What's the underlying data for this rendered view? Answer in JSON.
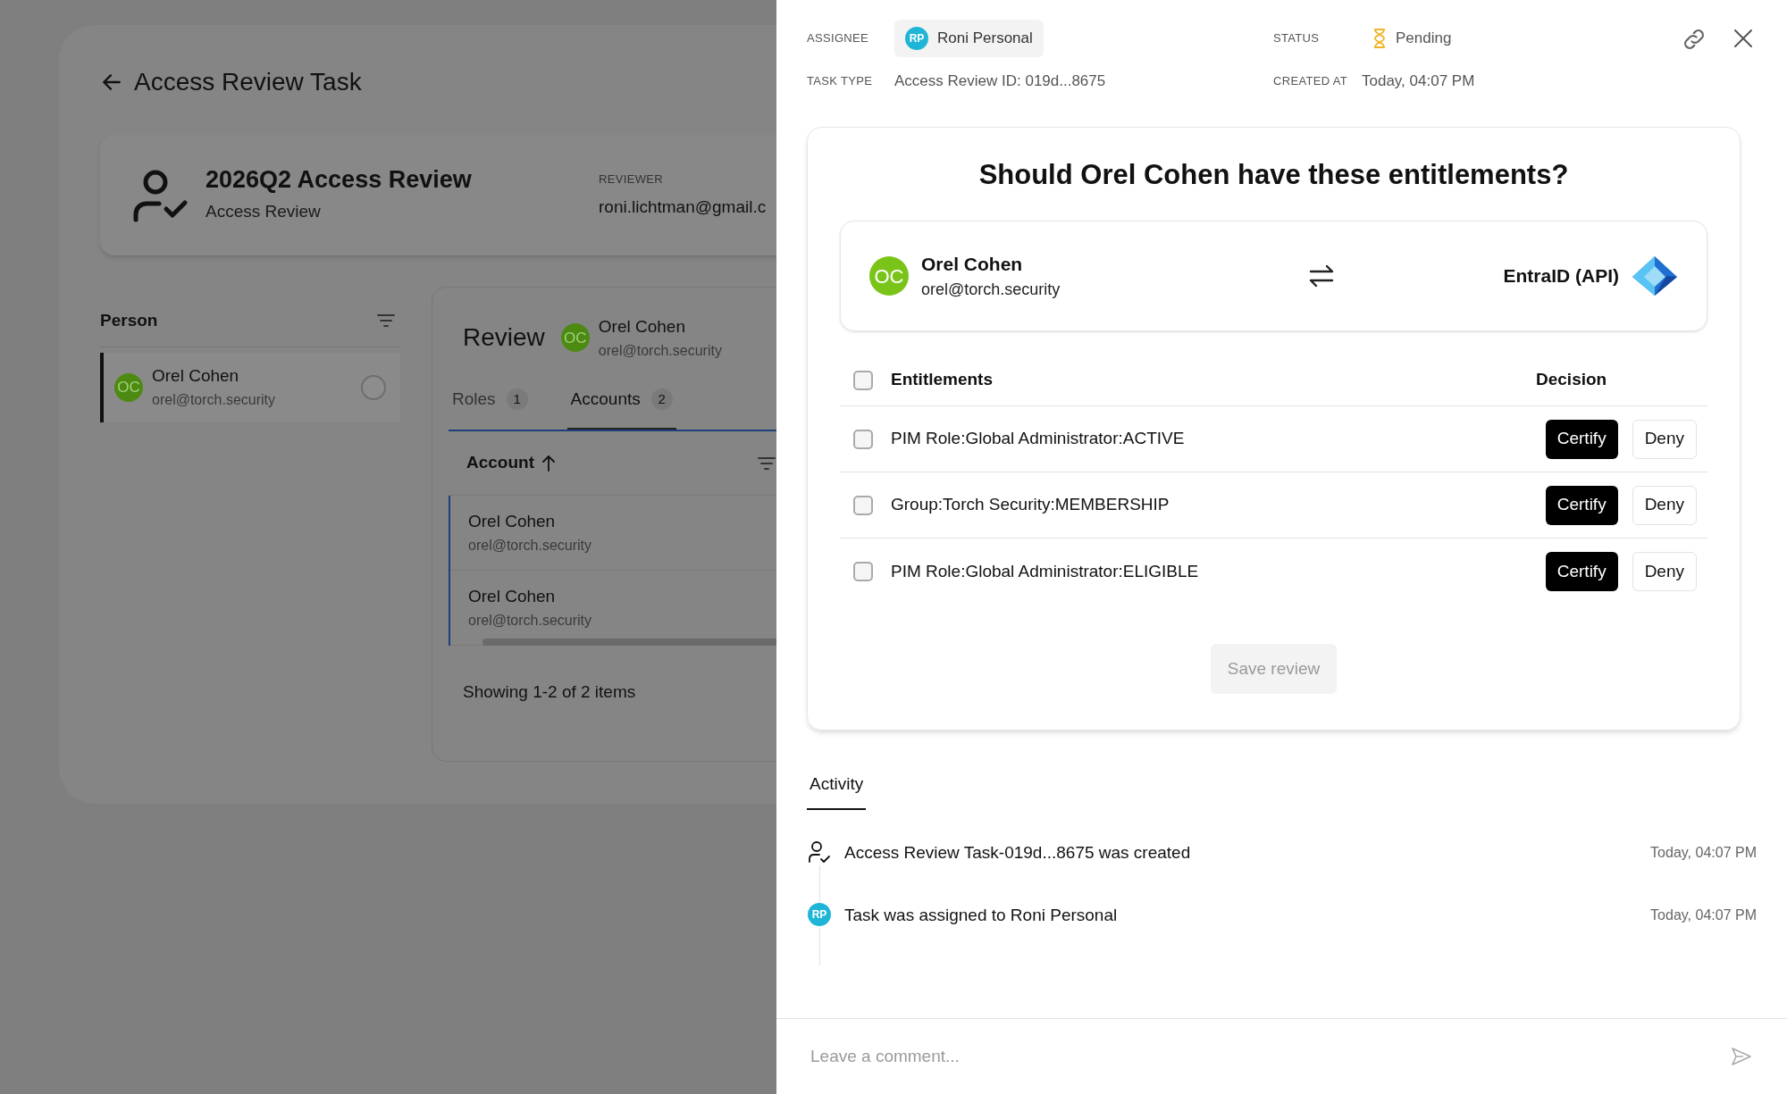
{
  "background_page": {
    "title": "Access Review Task",
    "summary": {
      "title": "2026Q2 Access Review",
      "subtitle": "Access Review",
      "reviewer_label": "REVIEWER",
      "reviewer": "roni.lichtman@gmail.c"
    },
    "person_panel": {
      "heading": "Person",
      "items": [
        {
          "initials": "OC",
          "name": "Orel Cohen",
          "email": "orel@torch.security",
          "selected": true,
          "checked": false
        }
      ]
    },
    "review_panel": {
      "heading": "Review",
      "person": {
        "initials": "OC",
        "name": "Orel Cohen",
        "email": "orel@torch.security"
      },
      "tabs": [
        {
          "label": "Roles",
          "count": "1",
          "selected": false
        },
        {
          "label": "Accounts",
          "count": "2",
          "selected": true
        }
      ],
      "table": {
        "column": "Account",
        "rows": [
          {
            "name": "Orel Cohen",
            "email": "orel@torch.security"
          },
          {
            "name": "Orel Cohen",
            "email": "orel@torch.security"
          }
        ]
      },
      "footer": "Showing 1-2 of 2 items"
    }
  },
  "drawer": {
    "assignee_label": "ASSIGNEE",
    "assignee": {
      "initials": "RP",
      "name": "Roni Personal"
    },
    "status_label": "STATUS",
    "status": "Pending",
    "task_type_label": "TASK TYPE",
    "task_type": "Access Review ID: 019d...8675",
    "created_at_label": "CREATED AT",
    "created_at": "Today, 04:07 PM",
    "question": "Should Orel Cohen have these entitlements?",
    "identity": {
      "initials": "OC",
      "name": "Orel Cohen",
      "email": "orel@torch.security"
    },
    "application": "EntraID (API)",
    "entitlements": {
      "header": "Entitlements",
      "decision_header": "Decision",
      "all_checked": false,
      "rows": [
        {
          "name": "PIM Role:Global Administrator:ACTIVE",
          "checked": false,
          "certify": "Certify",
          "deny": "Deny"
        },
        {
          "name": "Group:Torch Security:MEMBERSHIP",
          "checked": false,
          "certify": "Certify",
          "deny": "Deny"
        },
        {
          "name": "PIM Role:Global Administrator:ELIGIBLE",
          "checked": false,
          "certify": "Certify",
          "deny": "Deny"
        }
      ]
    },
    "save_button": {
      "label": "Save review",
      "disabled": true
    },
    "activity_tab": {
      "label": "Activity",
      "selected": true
    },
    "activity": [
      {
        "kind": "created",
        "text": "Access Review Task-019d...8675 was created",
        "time": "Today, 04:07 PM"
      },
      {
        "kind": "assigned",
        "initials": "RP",
        "text": "Task was assigned to Roni Personal",
        "time": "Today, 04:07 PM"
      }
    ],
    "comment_placeholder": "Leave a comment..."
  }
}
